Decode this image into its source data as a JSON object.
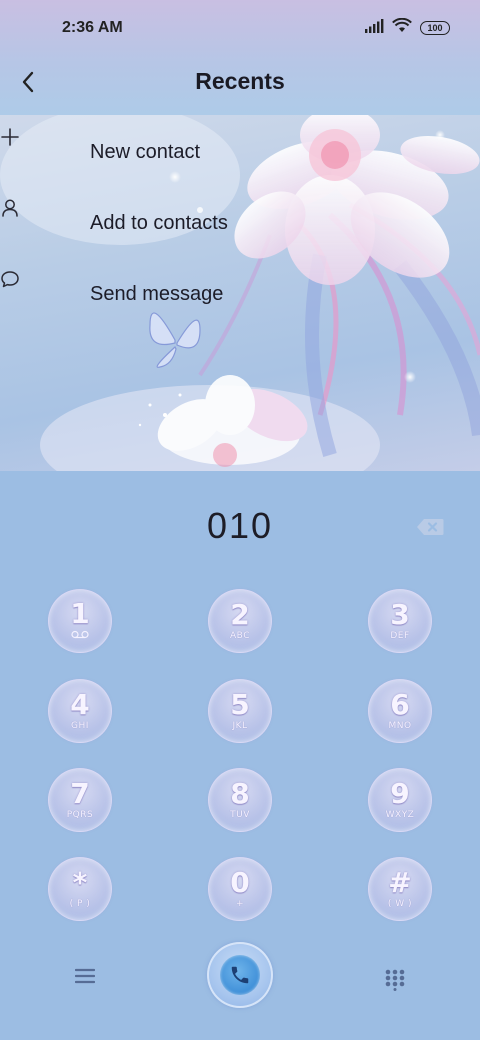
{
  "status_bar": {
    "time": "2:36 AM",
    "battery": "100",
    "icons": [
      "signal-icon",
      "wifi-icon",
      "battery-icon"
    ]
  },
  "header": {
    "title": "Recents",
    "back_icon": "back-arrow-icon"
  },
  "actions": [
    {
      "label": "New contact",
      "icon": "plus-icon"
    },
    {
      "label": "Add to contacts",
      "icon": "person-icon"
    },
    {
      "label": "Send message",
      "icon": "message-bubble-icon"
    }
  ],
  "dialer": {
    "number": "010",
    "backspace_icon": "backspace-icon",
    "keys": [
      {
        "digit": "1",
        "letters": "voicemail"
      },
      {
        "digit": "2",
        "letters": "ABC"
      },
      {
        "digit": "3",
        "letters": "DEF"
      },
      {
        "digit": "4",
        "letters": "GHI"
      },
      {
        "digit": "5",
        "letters": "JKL"
      },
      {
        "digit": "6",
        "letters": "MNO"
      },
      {
        "digit": "7",
        "letters": "PQRS"
      },
      {
        "digit": "8",
        "letters": "TUV"
      },
      {
        "digit": "9",
        "letters": "WXYZ"
      },
      {
        "digit": "*",
        "letters": "( P )"
      },
      {
        "digit": "0",
        "letters": "+"
      },
      {
        "digit": "#",
        "letters": "( W )"
      }
    ]
  },
  "bottom_bar": {
    "menu_icon": "menu-icon",
    "call_icon": "phone-call-icon",
    "dialpad_icon": "dialpad-icon"
  },
  "colors": {
    "dial_background": "#9cbde3",
    "call_button": "#3f8fd8"
  }
}
